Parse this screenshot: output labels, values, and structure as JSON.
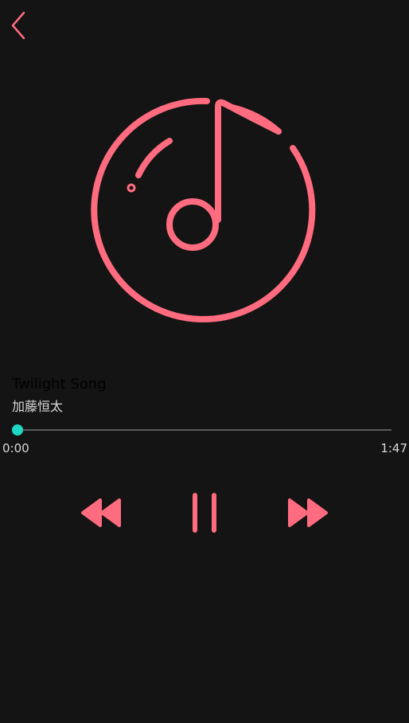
{
  "colors": {
    "accent": "#ff6b7f",
    "progress": "#1dd8c2",
    "background": "#141414"
  },
  "header": {
    "back_icon": "chevron-left-icon"
  },
  "album_art": {
    "icon": "music-note-disc-icon"
  },
  "track": {
    "title": "Twilight Song",
    "artist": "加藤恒太"
  },
  "progress": {
    "current_time": "0:00",
    "total_time": "1:47",
    "fraction": 0
  },
  "controls": {
    "rewind_icon": "rewind-icon",
    "pause_icon": "pause-icon",
    "forward_icon": "fast-forward-icon"
  }
}
